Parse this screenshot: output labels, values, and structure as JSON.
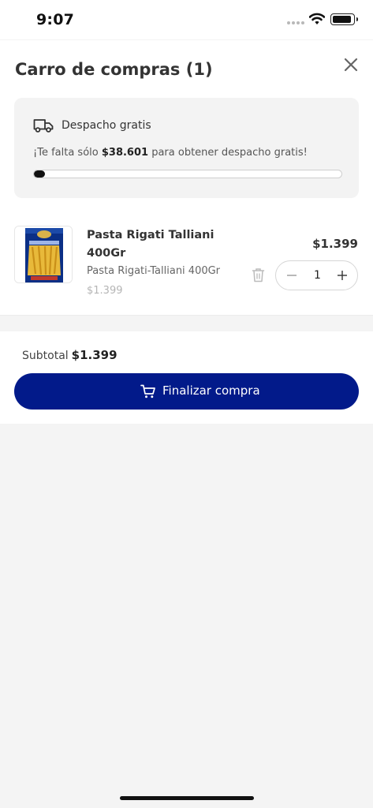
{
  "status_bar": {
    "time": "9:07"
  },
  "cart": {
    "title": "Carro de compras (1)",
    "shipping": {
      "title": "Despacho gratis",
      "msg_prefix": "¡Te falta sólo ",
      "msg_amount": "$38.601",
      "msg_suffix": " para obtener despacho gratis!",
      "progress_fraction": 0.035
    },
    "items": [
      {
        "name": "Pasta Rigati Talliani 400Gr",
        "description": "Pasta Rigati-Talliani 400Gr",
        "unit_price": "$1.399",
        "price": "$1.399",
        "quantity": "1"
      }
    ],
    "subtotal_label": "Subtotal",
    "subtotal_value": "$1.399",
    "checkout_label": "Finalizar compra"
  },
  "colors": {
    "primary": "#021a8a",
    "progress": "#111111",
    "background": "#f4f4f4"
  },
  "icons": [
    "signal-icon",
    "wifi-icon",
    "battery-icon",
    "close-icon",
    "truck-icon",
    "trash-icon",
    "minus-icon",
    "plus-icon",
    "cart-icon"
  ]
}
